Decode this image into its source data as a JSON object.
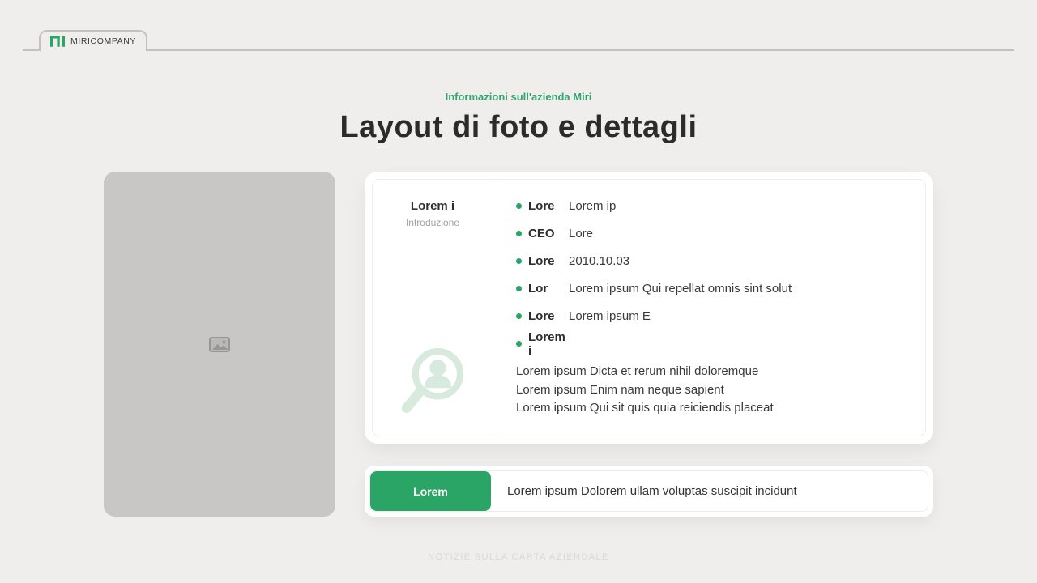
{
  "tab": {
    "company": "MIRICOMPANY"
  },
  "header": {
    "eyebrow": "Informazioni sull'azienda Miri",
    "title": "Layout di foto e dettagli"
  },
  "card": {
    "profile": {
      "title": "Lorem i",
      "subtitle": "Introduzione"
    },
    "details": [
      {
        "label": "Lore",
        "value": "Lorem ip"
      },
      {
        "label": "CEO",
        "value": "Lore"
      },
      {
        "label": "Lore",
        "value": "2010.10.03"
      },
      {
        "label": "Lor",
        "value": "Lorem ipsum Qui repellat omnis sint solut"
      },
      {
        "label": "Lore",
        "value": "Lorem ipsum E"
      },
      {
        "label": "Lorem i",
        "value": ""
      }
    ],
    "paragraph": [
      "Lorem ipsum Dicta et rerum nihil doloremque",
      "Lorem ipsum Enim nam neque sapient",
      "Lorem ipsum Qui sit quis quia reiciendis placeat"
    ]
  },
  "cta": {
    "button": "Lorem",
    "text": "Lorem ipsum Dolorem ullam voluptas suscipit incidunt"
  },
  "footer": {
    "note": "NOTIZIE SULLA CARTA AZIENDALE"
  },
  "colors": {
    "accent": "#2aa565",
    "accent_light": "#d8eade",
    "page_background": "#efeeed",
    "eyebrow_green": "#35a46f"
  }
}
